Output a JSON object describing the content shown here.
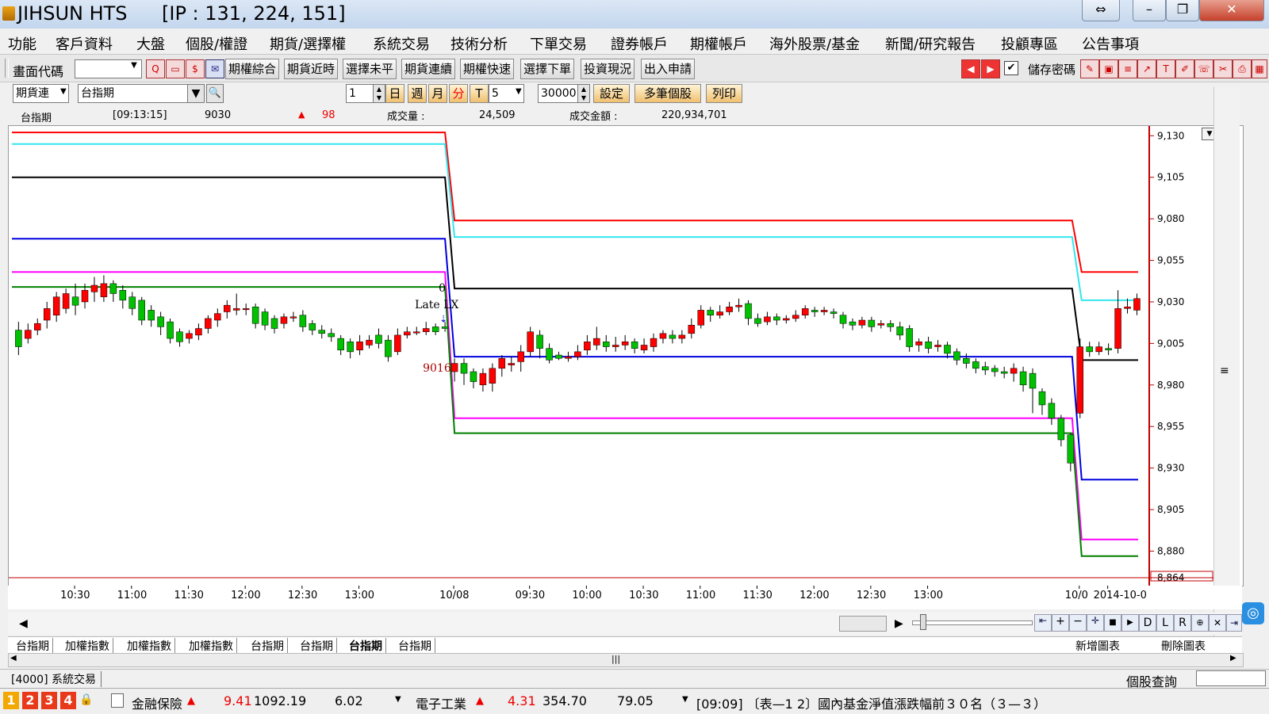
{
  "window": {
    "title": "JIHSUN HTS",
    "ip": "[IP : 131, 224, 151]"
  },
  "menu": [
    "功能",
    "客戶資料",
    "大盤",
    "個股/權證",
    "期貨/選擇權",
    "系統交易",
    "技術分析",
    "下單交易",
    "證券帳戶",
    "期權帳戶",
    "海外股票/基金",
    "新聞/研究報告",
    "投顧專區",
    "公告事項"
  ],
  "toolbar1": {
    "code_label": "畫面代碼",
    "code_value": "",
    "buttons": [
      "期權綜合",
      "期貨近時",
      "選擇未平",
      "期貨連續",
      "期權快速",
      "選擇下單",
      "投資現況",
      "出入申請"
    ],
    "save_password_label": "儲存密碼",
    "save_password_checked": true
  },
  "toolbar2": {
    "market_select": "期貨連",
    "symbol": "台指期",
    "count": "1",
    "periods": [
      "日",
      "週",
      "月",
      "分",
      "T"
    ],
    "active_period": "分",
    "interval": "5",
    "bars": "30000",
    "buttons": [
      "設定",
      "多筆個股",
      "列印"
    ]
  },
  "quote": {
    "name": "台指期",
    "time": "[09:13:15]",
    "price": "9030",
    "change": "98",
    "volume_label": "成交量 :",
    "volume": "24,509",
    "amount_label": "成交金額 :",
    "amount": "220,934,701"
  },
  "chart_data": {
    "type": "candlestick",
    "y_ticks": [
      "9,130",
      "9,105",
      "9,080",
      "9,055",
      "9,030",
      "9,005",
      "8,980",
      "8,955",
      "8,930",
      "8,905",
      "8,880",
      "8,864"
    ],
    "ylim": [
      8864,
      9133
    ],
    "x_ticks": [
      "10:30",
      "11:00",
      "11:30",
      "12:00",
      "12:30",
      "13:00",
      "10/08",
      "09:30",
      "10:00",
      "10:30",
      "11:00",
      "11:30",
      "12:00",
      "12:30",
      "13:00",
      "10/0",
      "2014-10-0"
    ],
    "annotations": [
      "0",
      "Late LX",
      "9016"
    ],
    "series": [
      {
        "color": "#ff0000",
        "levels": [
          9132,
          9079,
          9048
        ]
      },
      {
        "color": "#33e6ee",
        "levels": [
          9125,
          9069,
          9031
        ]
      },
      {
        "color": "#000000",
        "levels": [
          9105,
          9038,
          8995
        ]
      },
      {
        "color": "#0000e0",
        "levels": [
          9068,
          8997,
          8923
        ]
      },
      {
        "color": "#ff00ff",
        "levels": [
          9048,
          8960,
          8887
        ]
      },
      {
        "color": "#008000",
        "levels": [
          9039,
          8951,
          8877
        ]
      }
    ],
    "candles": [
      [
        9013,
        9003,
        9018,
        8998
      ],
      [
        9008,
        9013,
        9017,
        9005
      ],
      [
        9013,
        9017,
        9020,
        9010
      ],
      [
        9019,
        9026,
        9030,
        9014
      ],
      [
        9022,
        9033,
        9036,
        9018
      ],
      [
        9026,
        9035,
        9038,
        9023
      ],
      [
        9033,
        9028,
        9041,
        9022
      ],
      [
        9030,
        9037,
        9041,
        9026
      ],
      [
        9036,
        9040,
        9045,
        9030
      ],
      [
        9033,
        9041,
        9046,
        9030
      ],
      [
        9041,
        9035,
        9043,
        9030
      ],
      [
        9037,
        9031,
        9040,
        9026
      ],
      [
        9033,
        9026,
        9036,
        9022
      ],
      [
        9031,
        9019,
        9033,
        9016
      ],
      [
        9025,
        9019,
        9028,
        9015
      ],
      [
        9021,
        9015,
        9024,
        9010
      ],
      [
        9018,
        9008,
        9020,
        9005
      ],
      [
        9012,
        9006,
        9014,
        9003
      ],
      [
        9008,
        9011,
        9013,
        9005
      ],
      [
        9010,
        9014,
        9017,
        9007
      ],
      [
        9014,
        9020,
        9022,
        9011
      ],
      [
        9019,
        9023,
        9026,
        9015
      ],
      [
        9024,
        9028,
        9031,
        9020
      ],
      [
        9025,
        9026,
        9035,
        9022
      ],
      [
        9026,
        9026,
        9029,
        9022
      ],
      [
        9027,
        9017,
        9029,
        9014
      ],
      [
        9024,
        9016,
        9026,
        9013
      ],
      [
        9020,
        9014,
        9022,
        9011
      ],
      [
        9017,
        9021,
        9023,
        9014
      ],
      [
        9021,
        9021,
        9024,
        9018
      ],
      [
        9022,
        9015,
        9025,
        9012
      ],
      [
        9017,
        9013,
        9019,
        9010
      ],
      [
        9013,
        9011,
        9016,
        9008
      ],
      [
        9011,
        9009,
        9014,
        9006
      ],
      [
        9008,
        9001,
        9010,
        8998
      ],
      [
        9006,
        9000,
        9008,
        8996
      ],
      [
        9001,
        9006,
        9010,
        8998
      ],
      [
        9004,
        9007,
        9010,
        9002
      ],
      [
        9010,
        9005,
        9014,
        9002
      ],
      [
        9007,
        8997,
        9010,
        8994
      ],
      [
        9000,
        9010,
        9014,
        8998
      ],
      [
        9010,
        9012,
        9015,
        9008
      ],
      [
        9012,
        9012,
        9015,
        9010
      ],
      [
        9012,
        9014,
        9018,
        9010
      ],
      [
        9015,
        9012,
        9017,
        9010
      ],
      [
        9015,
        9014,
        9018,
        9012
      ],
      [
        8988,
        8993,
        8996,
        8982
      ],
      [
        8993,
        8987,
        8996,
        8980
      ],
      [
        8988,
        8982,
        8990,
        8978
      ],
      [
        8980,
        8987,
        8990,
        8976
      ],
      [
        8981,
        8990,
        8993,
        8976
      ],
      [
        8990,
        8996,
        8998,
        8985
      ],
      [
        8992,
        8993,
        8997,
        8988
      ],
      [
        8994,
        9000,
        9004,
        8988
      ],
      [
        9000,
        9012,
        9015,
        8997
      ],
      [
        9010,
        9002,
        9013,
        8996
      ],
      [
        9002,
        8995,
        9005,
        8993
      ],
      [
        8998,
        8996,
        9000,
        8995
      ],
      [
        8996,
        8997,
        9000,
        8994
      ],
      [
        8997,
        9000,
        9004,
        8995
      ],
      [
        9001,
        9006,
        9010,
        8998
      ],
      [
        9004,
        9008,
        9015,
        9001
      ],
      [
        9006,
        9003,
        9010,
        9000
      ],
      [
        9003,
        9004,
        9009,
        9000
      ],
      [
        9004,
        9006,
        9010,
        9001
      ],
      [
        9006,
        9002,
        9008,
        8999
      ],
      [
        9001,
        9004,
        9008,
        8999
      ],
      [
        9003,
        9008,
        9011,
        9000
      ],
      [
        9008,
        9011,
        9013,
        9005
      ],
      [
        9010,
        9008,
        9013,
        9005
      ],
      [
        9008,
        9010,
        9013,
        9005
      ],
      [
        9011,
        9016,
        9020,
        9008
      ],
      [
        9016,
        9025,
        9028,
        9014
      ],
      [
        9025,
        9022,
        9027,
        9018
      ],
      [
        9022,
        9024,
        9028,
        9020
      ],
      [
        9024,
        9027,
        9030,
        9022
      ],
      [
        9027,
        9028,
        9032,
        9024
      ],
      [
        9029,
        9020,
        9031,
        9016
      ],
      [
        9020,
        9017,
        9023,
        9015
      ],
      [
        9018,
        9021,
        9024,
        9016
      ],
      [
        9021,
        9019,
        9023,
        9016
      ],
      [
        9019,
        9020,
        9022,
        9017
      ],
      [
        9020,
        9022,
        9025,
        9018
      ],
      [
        9022,
        9026,
        9028,
        9020
      ],
      [
        9025,
        9024,
        9027,
        9021
      ],
      [
        9024,
        9025,
        9027,
        9022
      ],
      [
        9024,
        9023,
        9026,
        9020
      ],
      [
        9022,
        9017,
        9024,
        9014
      ],
      [
        9018,
        9016,
        9020,
        9013
      ],
      [
        9016,
        9019,
        9021,
        9014
      ],
      [
        9019,
        9015,
        9021,
        9012
      ],
      [
        9016,
        9017,
        9019,
        9014
      ],
      [
        9017,
        9015,
        9019,
        9012
      ],
      [
        9015,
        9010,
        9018,
        9007
      ],
      [
        9014,
        9003,
        9016,
        9000
      ],
      [
        9004,
        9006,
        9008,
        9000
      ],
      [
        9006,
        9002,
        9009,
        8999
      ],
      [
        9003,
        9004,
        9007,
        9000
      ],
      [
        9004,
        8999,
        9006,
        8996
      ],
      [
        9000,
        8995,
        9002,
        8992
      ],
      [
        8996,
        8993,
        8999,
        8990
      ],
      [
        8994,
        8990,
        8996,
        8987
      ],
      [
        8991,
        8989,
        8994,
        8986
      ],
      [
        8990,
        8988,
        8992,
        8985
      ],
      [
        8988,
        8987,
        8991,
        8984
      ],
      [
        8987,
        8990,
        8993,
        8982
      ],
      [
        8988,
        8980,
        8991,
        8976
      ],
      [
        8987,
        8978,
        8990,
        8963
      ],
      [
        8976,
        8968,
        8978,
        8962
      ],
      [
        8969,
        8960,
        8972,
        8956
      ],
      [
        8960,
        8947,
        8962,
        8943
      ],
      [
        8950,
        8933,
        8951,
        8928
      ],
      [
        8963,
        9003,
        9008,
        8960
      ],
      [
        9003,
        9000,
        9006,
        8997
      ],
      [
        9000,
        9003,
        9006,
        8998
      ],
      [
        9002,
        9001,
        9005,
        8998
      ],
      [
        9002,
        9026,
        9037,
        8999
      ],
      [
        9026,
        9027,
        9032,
        9023
      ],
      [
        9025,
        9032,
        9035,
        9022
      ]
    ]
  },
  "nav_buttons": [
    "D",
    "L",
    "R"
  ],
  "tabs": [
    "台指期",
    "加權指數",
    "加權指數",
    "加權指數",
    "台指期",
    "台指期",
    "台指期",
    "台指期"
  ],
  "active_tab": 6,
  "chart_actions": [
    "新增圖表",
    "刪除圖表"
  ],
  "status1": {
    "left": "[4000] 系統交易",
    "right_label": "個股查詢",
    "right_value": ""
  },
  "status2": {
    "tabs": [
      "1",
      "2",
      "3",
      "4"
    ],
    "ticker1": {
      "name": "金融保險",
      "pct": "9.41",
      "index": "1092.19",
      "change": "6.02"
    },
    "ticker2": {
      "name": "電子工業",
      "pct": "4.31",
      "index": "354.70",
      "change": "79.05"
    },
    "news": "[09:09] 〔表—1 2〕國內基金淨值漲跌幅前３０名（３—３）"
  },
  "colors": {
    "up": "#ff0000",
    "down": "#00c000",
    "axis": "#c00000"
  }
}
